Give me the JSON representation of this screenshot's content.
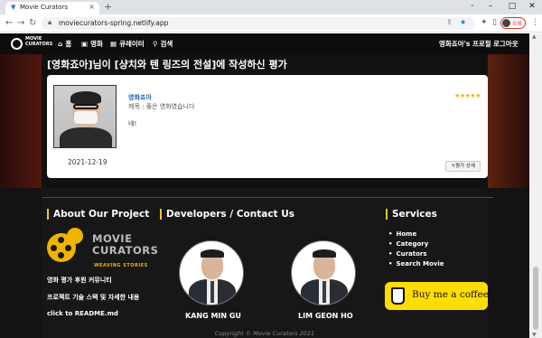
{
  "browser": {
    "tab_title": "Movie Curators",
    "url": "moviecurators-spring.netlify.app",
    "profile_label": "오류",
    "new_tab_symbol": "+",
    "close_symbol": "×",
    "minimize_symbol": "–",
    "maximize_symbol": "□",
    "window_close_symbol": "✕",
    "back_symbol": "←",
    "forward_symbol": "→",
    "reload_symbol": "↻",
    "tabdrop_symbol": "⌄"
  },
  "nav": {
    "logo_line1": "MOVIE",
    "logo_line2": "CURATORS",
    "links": [
      {
        "icon": "⌂",
        "label": "홈"
      },
      {
        "icon": "▣",
        "label": "영화"
      },
      {
        "icon": "▦",
        "label": "큐레이터"
      },
      {
        "icon": "⚲",
        "label": "검색"
      }
    ],
    "profile_link": "영화죠아's 프로필",
    "logout_link": "로그아웃"
  },
  "page": {
    "heading": "[영화죠아]님이 [샹치와 텐 링즈의 전설]에 작성하신 평가"
  },
  "review": {
    "reviewer": "영화죠아",
    "title": "제목 : 좋은 영화였습니다",
    "body": "네!",
    "stars": "★★★★★",
    "rating": 5,
    "date": "2021-12-19",
    "detail_button": "↰평가 상세"
  },
  "footer": {
    "about_heading": "About Our Project",
    "logo_big": "MOVIE CURATORS",
    "logo_sub": "WEAVING STORIES",
    "about_lines": [
      "영화 평가 후원 커뮤니티",
      "프로젝트 기술 스택 및 자세한 내용",
      "click to README.md"
    ],
    "developers_heading": "Developers / Contact Us",
    "developers": [
      {
        "name": "KANG MIN GU"
      },
      {
        "name": "LIM GEON HO"
      }
    ],
    "services_heading": "Services",
    "services": [
      "Home",
      "Category",
      "Curators",
      "Search Movie"
    ],
    "coffee_label": "Buy me a coffee",
    "copyright": "Copyright © Movie Curators 2021"
  },
  "colors": {
    "accent_yellow": "#f5c518",
    "coffee_yellow": "#ffdd00",
    "link_blue": "#1a5fb4",
    "star_gold": "#f0b400"
  }
}
